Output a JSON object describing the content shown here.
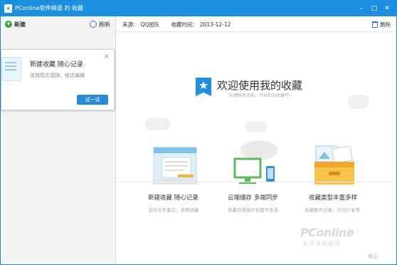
{
  "window": {
    "title": "PConline软件频道 的 收藏",
    "minimize": "–",
    "maximize": "□",
    "close": "✕"
  },
  "sidebar": {
    "new_label": "新建",
    "refresh_label": "刷新",
    "popup": {
      "title": "新建收藏 随心记录",
      "desc": "支持图文混排、格式编辑",
      "button": "试一试",
      "close": "×"
    }
  },
  "toolbar": {
    "source_label": "来源：",
    "source_value": "QQ团队",
    "time_label": "收藏时间：",
    "time_value": "2013-12-12",
    "delete_label": "删除"
  },
  "hero": {
    "title": "欢迎使用我的收藏",
    "subtitle": "右键聊天消息，开始你的收藏吧~"
  },
  "features": [
    {
      "title": "新建收藏 随心记录",
      "desc": "支持文字备忘、多图收藏"
    },
    {
      "title": "云端储存 多端同步",
      "desc": "收藏后电脑手机都可查看"
    },
    {
      "title": "收藏类型丰富多样",
      "desc": "收藏聊天记录、空间分享等"
    }
  ],
  "watermark": {
    "brand": "PConline",
    "sub": "太平洋电脑网",
    "weibo": "微云"
  },
  "colors": {
    "brand_blue": "#1d8fe0",
    "button_blue": "#2a88d8",
    "sidebar_bg": "#f4f4f4"
  }
}
